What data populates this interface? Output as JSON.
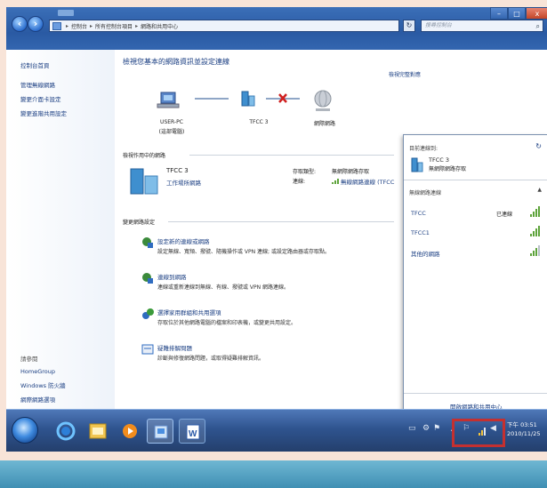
{
  "window": {
    "address_crumbs": [
      "控制台",
      "所有控制台項目",
      "網路和共用中心"
    ],
    "search_placeholder": "搜尋控制台",
    "controls": {
      "minimize": "–",
      "maximize": "□",
      "close": "x"
    }
  },
  "sidebar": {
    "home": "控制台首頁",
    "links": [
      "管理無線網路",
      "變更介面卡設定",
      "變更進階共用設定"
    ],
    "see_also_title": "請參閱",
    "see_also_links": [
      "HomeGroup",
      "Windows 防火牆",
      "網際網路選項"
    ]
  },
  "main": {
    "title": "檢視您基本的網路資訊並設定連線",
    "see_full_map": "檢視完整對應",
    "map_nodes": [
      {
        "name": "USER-PC",
        "sub": "(這部電腦)"
      },
      {
        "name": "TFCC 3",
        "sub": ""
      },
      {
        "name": "網際網路",
        "sub": ""
      }
    ],
    "active_networks_title": "檢視作用中的網路",
    "active_network": {
      "name": "TFCC 3",
      "type": "工作場所網路",
      "access_type_label": "存取類型:",
      "access_type_value": "連線:",
      "no_internet_label": "無網際網路存取",
      "connection_label": "無線網路連線 (TFCC"
    },
    "settings_title": "變更網路設定",
    "tasks": [
      {
        "link": "設定新的連線或網路",
        "desc": "設定無線、寬頻、撥號、隨機操作或 VPN 連線; 或設定路由器或存取點。"
      },
      {
        "link": "連線到網路",
        "desc": "連線或重新連線到無線、有線、撥號或 VPN 網路連線。"
      },
      {
        "link": "選擇家用群組和共用選項",
        "desc": "存取位於其他網路電腦的檔案和印表機，或變更共用設定。"
      },
      {
        "link": "疑難排解問題",
        "desc": "診斷與修復網路問題，或取得疑難排解資訊。"
      }
    ]
  },
  "popup": {
    "current_label": "目前連線到:",
    "current_network": "TFCC 3",
    "current_status": "無網際網路存取",
    "wireless_label": "無線網路連線",
    "networks": [
      {
        "name": "TFCC",
        "status": "已連線",
        "signal": 4
      },
      {
        "name": "TFCC1",
        "status": "",
        "signal": 4
      },
      {
        "name": "其他的網路",
        "status": "",
        "signal": 3
      }
    ],
    "footer_link": "開啟網路和共用中心"
  },
  "taskbar": {
    "time": "下午 03:51",
    "date": "2010/11/25"
  },
  "colors": {
    "link": "#1a3e82",
    "highlight_box": "#c43030",
    "taskbar": "#2f548f"
  }
}
